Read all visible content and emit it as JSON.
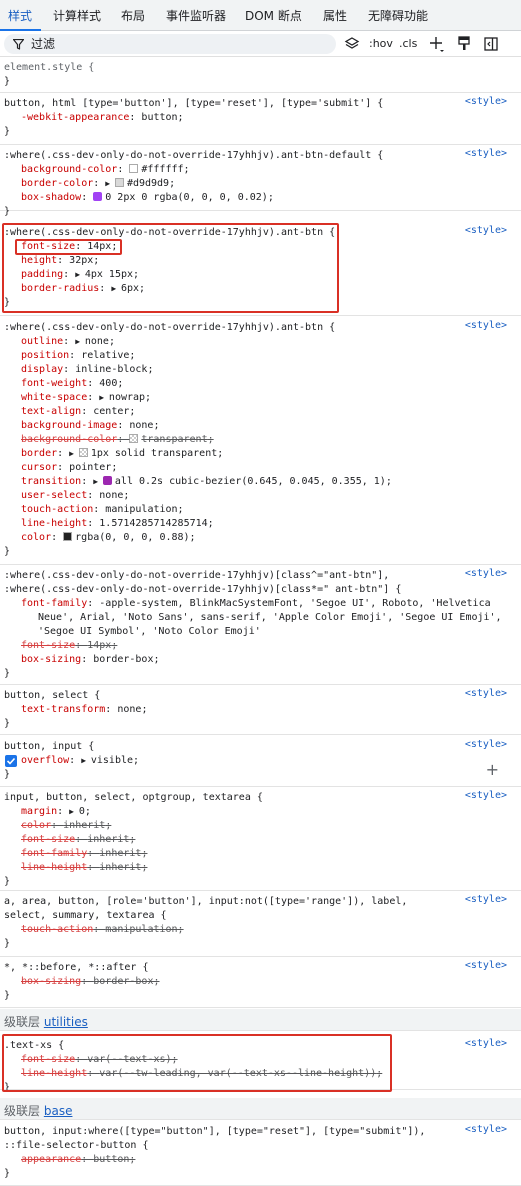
{
  "tabs": [
    "样式",
    "计算样式",
    "布局",
    "事件监听器",
    "DOM 断点",
    "属性",
    "无障碍功能"
  ],
  "toolbar": {
    "filter_placeholder": "过滤",
    "hov": ":hov",
    "cls": ".cls"
  },
  "source_label": "<style>",
  "rules": [
    {
      "selector": "element.style {",
      "decls": [],
      "close": "}"
    },
    {
      "selector": "button, html [type='button'], [type='reset'], [type='submit'] {",
      "decls": [
        {
          "p": "-webkit-appearance",
          "v": "button"
        }
      ],
      "close": "}"
    },
    {
      "selector": ":where(.css-dev-only-do-not-override-17yhhjv).ant-btn-default {",
      "decls": [
        {
          "p": "background-color",
          "v": "#ffffff",
          "swatch": "#ffffff"
        },
        {
          "p": "border-color",
          "v": "#d9d9d9",
          "swatch": "#d9d9d9",
          "tri": true
        },
        {
          "p": "box-shadow",
          "v": "0 2px 0 rgba(0, 0, 0, 0.02)"
        }
      ],
      "close": "}"
    },
    {
      "selector": ":where(.css-dev-only-do-not-override-17yhhjv).ant-btn {",
      "decls": [
        {
          "p": "font-size",
          "v": "14px"
        },
        {
          "p": "height",
          "v": "32px"
        },
        {
          "p": "padding",
          "v": "4px 15px",
          "tri": true
        },
        {
          "p": "border-radius",
          "v": "6px",
          "tri": true
        }
      ],
      "close": "}"
    },
    {
      "selector": ":where(.css-dev-only-do-not-override-17yhhjv).ant-btn {",
      "decls": [
        {
          "p": "outline",
          "v": "none",
          "tri": true
        },
        {
          "p": "position",
          "v": "relative"
        },
        {
          "p": "display",
          "v": "inline-block"
        },
        {
          "p": "font-weight",
          "v": "400"
        },
        {
          "p": "white-space",
          "v": "nowrap",
          "tri": true
        },
        {
          "p": "text-align",
          "v": "center"
        },
        {
          "p": "background-image",
          "v": "none"
        },
        {
          "p": "background-color",
          "v": "transparent",
          "strike": true
        },
        {
          "p": "border",
          "v": "1px solid transparent",
          "tri": true
        },
        {
          "p": "cursor",
          "v": "pointer"
        },
        {
          "p": "transition",
          "v": "all 0.2s cubic-bezier(0.645, 0.045, 0.355, 1)",
          "tri": true
        },
        {
          "p": "user-select",
          "v": "none"
        },
        {
          "p": "touch-action",
          "v": "manipulation"
        },
        {
          "p": "line-height",
          "v": "1.5714285714285714"
        },
        {
          "p": "color",
          "v": "rgba(0, 0, 0, 0.88)"
        }
      ],
      "close": "}"
    },
    {
      "selector_lines": [
        ":where(.css-dev-only-do-not-override-17yhhjv)[class^=\"ant-btn\"],",
        ":where(.css-dev-only-do-not-override-17yhhjv)[class*=\" ant-btn\"] {"
      ],
      "decls": [
        {
          "p": "font-family",
          "v_lines": [
            "-apple-system, BlinkMacSystemFont, 'Segoe UI', Roboto, 'Helvetica",
            "Neue', Arial, 'Noto Sans', sans-serif, 'Apple Color Emoji', 'Segoe UI Emoji',",
            "'Segoe UI Symbol', 'Noto Color Emoji'"
          ]
        },
        {
          "p": "font-size",
          "v": "14px",
          "strike": true
        },
        {
          "p": "box-sizing",
          "v": "border-box"
        }
      ],
      "close": "}"
    },
    {
      "selector": "button, select {",
      "decls": [
        {
          "p": "text-transform",
          "v": "none"
        }
      ],
      "close": "}"
    },
    {
      "selector": "button, input {",
      "decls": [
        {
          "p": "overflow",
          "v": "visible",
          "tri": true
        }
      ],
      "close": "}"
    },
    {
      "selector": "input, button, select, optgroup, textarea {",
      "decls": [
        {
          "p": "margin",
          "v": "0",
          "tri": true
        },
        {
          "p": "color",
          "v": "inherit",
          "strike": true
        },
        {
          "p": "font-size",
          "v": "inherit",
          "strike": true
        },
        {
          "p": "font-family",
          "v": "inherit",
          "strike": true
        },
        {
          "p": "line-height",
          "v": "inherit",
          "strike": true
        }
      ],
      "close": "}"
    },
    {
      "selector_lines": [
        "a, area, button, [role='button'], input:not([type='range']), label,",
        "select, summary, textarea {"
      ],
      "decls": [
        {
          "p": "touch-action",
          "v": "manipulation",
          "strike": true
        }
      ],
      "close": "}"
    },
    {
      "selector": "*, *::before, *::after {",
      "decls": [
        {
          "p": "box-sizing",
          "v": "border-box",
          "strike": true
        }
      ],
      "close": "}"
    },
    {
      "selector": ".text-xs {",
      "decls": [
        {
          "p": "font-size",
          "v": "var(--text-xs)",
          "strike": true
        },
        {
          "p": "line-height",
          "v": "var(--tw-leading, var(--text-xs--line-height))",
          "strike": true
        }
      ],
      "close": "}"
    },
    {
      "selector_lines": [
        "button, input:where([type=\"button\"], [type=\"reset\"], [type=\"submit\"]),",
        "::file-selector-button {"
      ],
      "decls": [
        {
          "p": "appearance",
          "v": "button",
          "strike": true
        }
      ],
      "close": "}"
    }
  ],
  "layers": [
    {
      "prefix": "级联层",
      "name": "utilities"
    },
    {
      "prefix": "级联层",
      "name": "base"
    }
  ]
}
